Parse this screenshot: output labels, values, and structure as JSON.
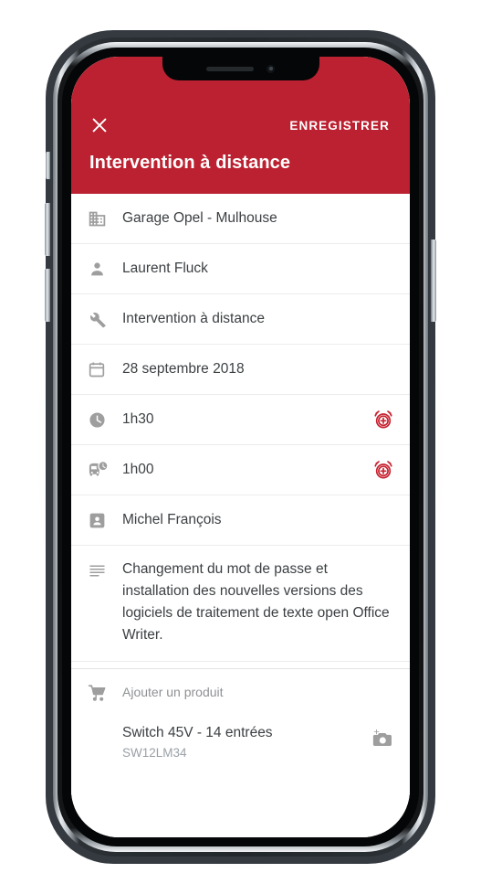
{
  "device": {
    "type": "smartphone-mockup",
    "notch": {
      "speaker": "speaker-grille",
      "camera": "front-camera"
    },
    "buttons": [
      "silent-switch",
      "volume-up",
      "volume-down",
      "power"
    ]
  },
  "colors": {
    "appbar": "#bb2130",
    "accent_alarm": "#c62330",
    "icon_grey": "#9e9e9e",
    "text_primary": "#3c4043",
    "text_secondary": "#9aa0a6",
    "frame": "#343a40"
  },
  "appbar": {
    "close_icon": "close-icon",
    "save_label": "ENREGISTRER",
    "title": "Intervention à distance"
  },
  "rows": [
    {
      "icon": "domain-icon",
      "text": "Garage Opel - Mulhouse",
      "trailing": null
    },
    {
      "icon": "person-icon",
      "text": "Laurent Fluck",
      "trailing": null
    },
    {
      "icon": "wrench-icon",
      "text": "Intervention à distance",
      "trailing": null
    },
    {
      "icon": "calendar-icon",
      "text": "28 septembre 2018",
      "trailing": null
    },
    {
      "icon": "clock-icon",
      "text": "1h30",
      "trailing": "add-alarm-icon"
    },
    {
      "icon": "bus-clock-icon",
      "text": "1h00",
      "trailing": "add-alarm-icon"
    },
    {
      "icon": "contact-card-icon",
      "text": "Michel François",
      "trailing": null
    },
    {
      "icon": "notes-icon",
      "text": "Changement du mot de passe et installation des nouvelles versions des logiciels de traitement de texte open Office Writer.",
      "trailing": null
    }
  ],
  "products": {
    "add_row": {
      "icon": "cart-icon",
      "label": "Ajouter un produit"
    },
    "items": [
      {
        "name": "Switch 45V - 14 entrées",
        "reference": "SW12LM34",
        "action_icon": "add-a-photo-icon"
      }
    ]
  }
}
